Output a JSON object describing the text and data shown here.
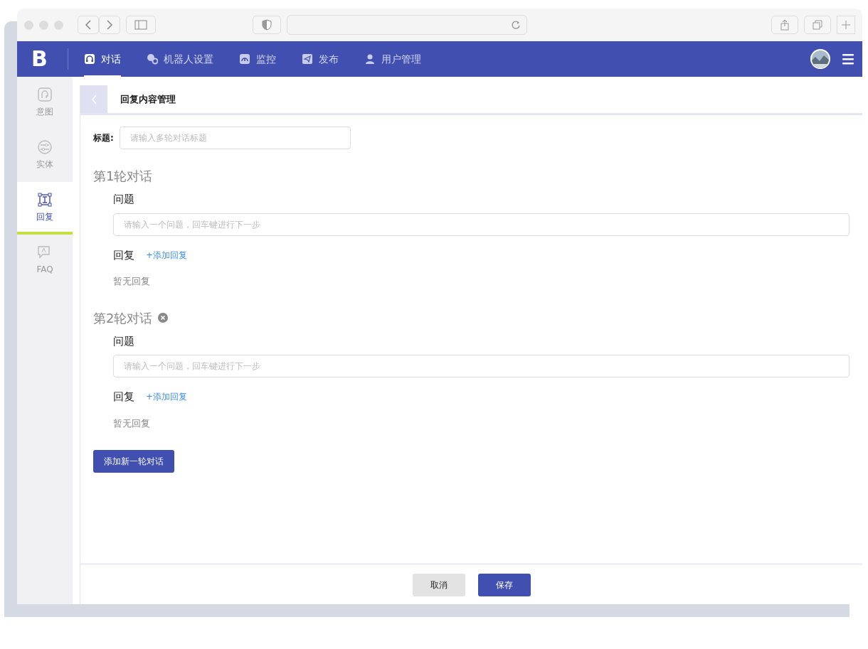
{
  "app": {
    "logo": "B"
  },
  "nav_tabs": [
    {
      "label": "对话",
      "selected": true
    },
    {
      "label": "机器人设置",
      "selected": false
    },
    {
      "label": "监控",
      "selected": false
    },
    {
      "label": "发布",
      "selected": false
    },
    {
      "label": "用户管理",
      "selected": false
    }
  ],
  "sidebar": {
    "items": [
      {
        "label": "意图",
        "selected": false
      },
      {
        "label": "实体",
        "selected": false
      },
      {
        "label": "回复",
        "selected": true
      },
      {
        "label": "FAQ",
        "selected": false
      }
    ]
  },
  "page": {
    "title": "回复内容管理",
    "title_field": {
      "label": "标题:",
      "placeholder": "请输入多轮对话标题"
    },
    "rounds": [
      {
        "title": "第1轮对话",
        "removable": false,
        "question_label": "问题",
        "question_placeholder": "请输入一个问题，回车键进行下一步",
        "reply_label": "回复",
        "add_reply": "+添加回复",
        "empty_text": "暂无回复"
      },
      {
        "title": "第2轮对话",
        "removable": true,
        "question_label": "问题",
        "question_placeholder": "请输入一个问题，回车键进行下一步",
        "reply_label": "回复",
        "add_reply": "+添加回复",
        "empty_text": "暂无回复"
      }
    ],
    "add_round_button": "添加新一轮对话"
  },
  "footer": {
    "cancel_button": "取消",
    "save_button": "保存"
  }
}
